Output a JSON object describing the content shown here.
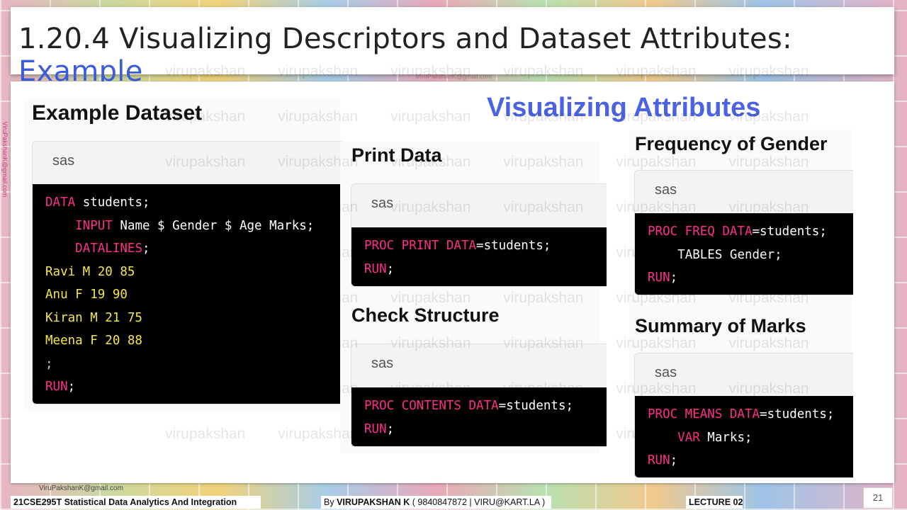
{
  "title": {
    "main": "1.20.4 Visualizing Descriptors and Dataset Attributes:",
    "accent": "Example"
  },
  "example_dataset": {
    "heading": "Example Dataset",
    "lang": "sas",
    "lines": [
      {
        "kw": "DATA",
        "rest": " students;"
      },
      {
        "indent": "    ",
        "kw": "INPUT",
        "rest": " Name $ Gender $ Age Marks;"
      },
      {
        "indent": "    ",
        "kw": "DATALINES",
        "rest": ";"
      },
      {
        "data": "Ravi M 20 85"
      },
      {
        "data": "Anu F 19 90"
      },
      {
        "data": "Kiran M 21 75"
      },
      {
        "data": "Meena F 20 88"
      },
      {
        "plain": ";"
      },
      {
        "kw": "RUN",
        "rest": ";"
      }
    ]
  },
  "visualizing_heading": "Visualizing Attributes",
  "print_data": {
    "heading": "Print Data",
    "lang": "sas",
    "line1_kw": "PROC PRINT DATA",
    "line1_rest": "=students;",
    "line2_kw": "RUN",
    "line2_rest": ";"
  },
  "check_structure": {
    "heading": "Check Structure",
    "lang": "sas",
    "line1_kw": "PROC CONTENTS DATA",
    "line1_rest": "=students;",
    "line2_kw": "RUN",
    "line2_rest": ";"
  },
  "freq_gender": {
    "heading": "Frequency of Gender",
    "lang": "sas",
    "line1_kw": "PROC FREQ DATA",
    "line1_rest": "=students;",
    "line2_kw": "TABLES",
    "line2_rest": " Gender;",
    "line3_kw": "RUN",
    "line3_rest": ";"
  },
  "summary_marks": {
    "heading": "Summary of Marks",
    "lang": "sas",
    "line1_kw": "PROC MEANS DATA",
    "line1_rest": "=students;",
    "line2_kw": "VAR",
    "line2_rest": " Marks;",
    "line3_kw": "RUN",
    "line3_rest": ";"
  },
  "watermark_text": "virupakshan virupakshan virupakshan virupakshan virupakshan virupakshan",
  "email_small": "ViruPakshanK@gmail.com",
  "side_email": "ViruPakshanK@gmail.com",
  "footer": {
    "course": "21CSE295T Statistical Data Analytics And Integration",
    "by_prefix": "By ",
    "author": "VIRUPAKSHAN K",
    "contact": " ( 9840847872 | VIRU@KART.LA )",
    "lecture": "LECTURE 02",
    "page": "21"
  }
}
